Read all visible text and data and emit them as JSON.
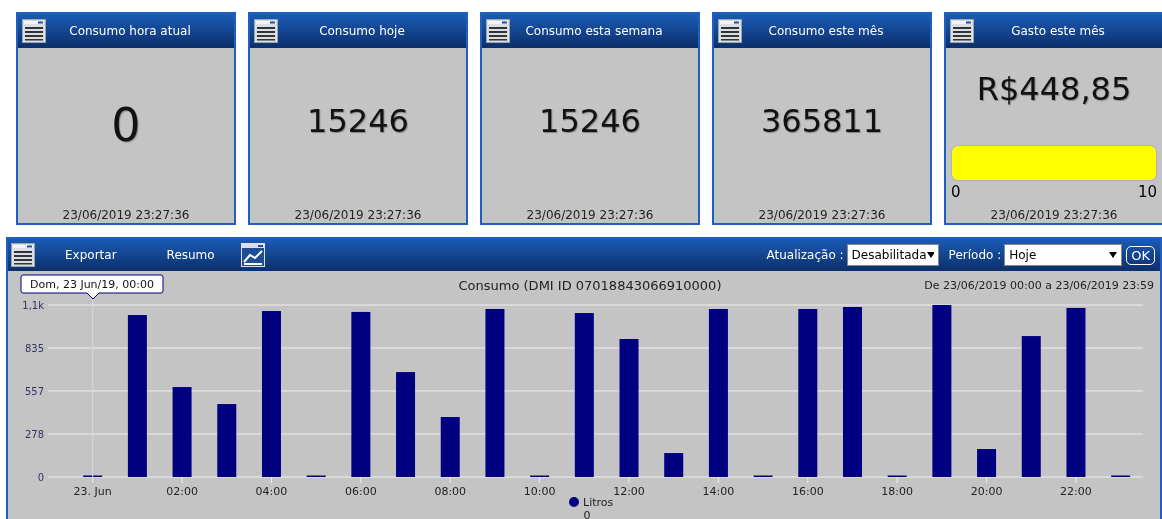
{
  "cards": [
    {
      "kind": "value_large",
      "title": "Consumo hora atual",
      "value": "0",
      "timestamp": "23/06/2019 23:27:36"
    },
    {
      "kind": "value",
      "title": "Consumo hoje",
      "value": "15246",
      "timestamp": "23/06/2019 23:27:36"
    },
    {
      "kind": "value",
      "title": "Consumo esta semana",
      "value": "15246",
      "timestamp": "23/06/2019 23:27:36"
    },
    {
      "kind": "value",
      "title": "Consumo este mês",
      "value": "365811",
      "timestamp": "23/06/2019 23:27:36"
    },
    {
      "kind": "gauge",
      "title": "Gasto este mês",
      "value": "R$448,85",
      "level": 1,
      "min_label": "0",
      "max_label": "10",
      "timestamp": "23/06/2019 23:27:36"
    }
  ],
  "toolbar": {
    "links": [
      "Exportar",
      "Resumo"
    ],
    "refresh_label": "Atualização :",
    "refresh_value": "Desabilitada",
    "period_label": "Período :",
    "period_value": "Hoje",
    "ok": "OK"
  },
  "chart": {
    "title": "Consumo (DMI ID 07018843066910000)",
    "range": "De 23/06/2019 00:00 a 23/06/2019 23:59",
    "tooltip": "Dom, 23 Jun/19, 00:00",
    "legend_value": "0",
    "chart_data": {
      "type": "bar",
      "grid": true,
      "x": [
        0,
        1,
        2,
        3,
        4,
        5,
        6,
        7,
        8,
        9,
        10,
        11,
        12,
        13,
        14,
        15,
        16,
        17,
        18,
        19,
        20,
        21,
        22,
        23
      ],
      "series": [
        {
          "name": "Litros",
          "color": "#000080",
          "values": [
            0,
            1048,
            582,
            472,
            1074,
            0,
            1068,
            679,
            388,
            1087,
            0,
            1061,
            893,
            155,
            1087,
            0,
            1087,
            1100,
            0,
            1113,
            181,
            912,
            1094,
            0
          ]
        }
      ],
      "xlim": [
        -1,
        23.5
      ],
      "ylim": [
        0,
        1113
      ],
      "yticks": [
        0,
        278,
        557,
        835,
        {
          "value": 1113,
          "label": "1,1k"
        }
      ],
      "xticks": [
        {
          "value": 0,
          "label": "23. Jun"
        },
        {
          "value": 2,
          "label": "02:00"
        },
        {
          "value": 4,
          "label": "04:00"
        },
        {
          "value": 6,
          "label": "06:00"
        },
        {
          "value": 8,
          "label": "08:00"
        },
        {
          "value": 10,
          "label": "10:00"
        },
        {
          "value": 12,
          "label": "12:00"
        },
        {
          "value": 14,
          "label": "14:00"
        },
        {
          "value": 16,
          "label": "16:00"
        },
        {
          "value": 18,
          "label": "18:00"
        },
        {
          "value": 20,
          "label": "20:00"
        },
        {
          "value": 22,
          "label": "22:00"
        }
      ]
    }
  }
}
